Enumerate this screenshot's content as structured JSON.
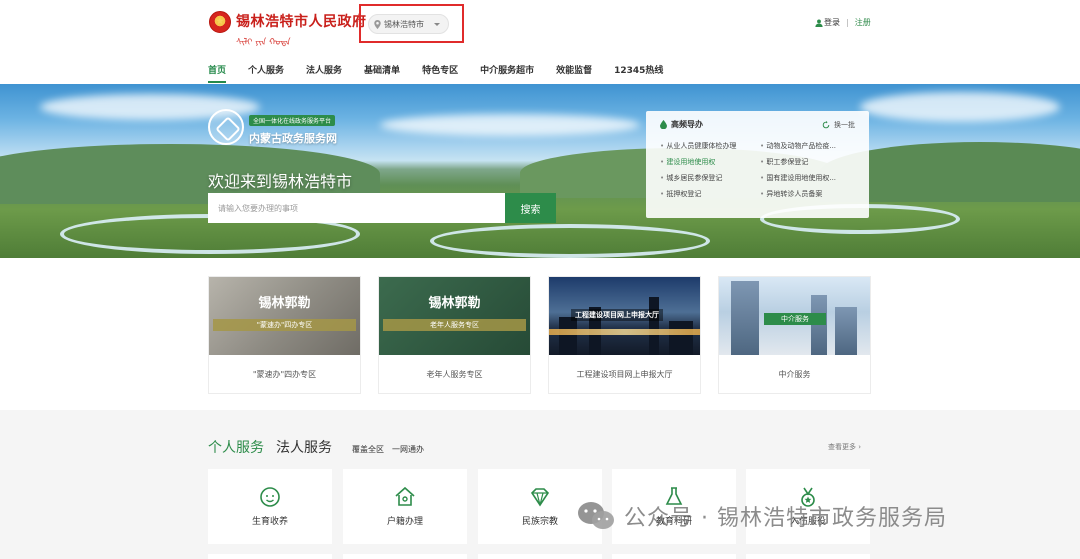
{
  "header": {
    "site_title": "锡林浩特市人民政府",
    "mongolian_line": "ᠰᠢᠯᠢ ᠶᠢᠨ ᠬᠣᠲᠠ",
    "city": "锡林浩特市",
    "login": "登录",
    "separator": "|",
    "register": "注册"
  },
  "nav": [
    "首页",
    "个人服务",
    "法人服务",
    "基础清单",
    "特色专区",
    "中介服务超市",
    "效能监督",
    "12345热线"
  ],
  "hero": {
    "platform_tag": "全国一体化在线政务服务平台",
    "platform_name": "内蒙古政务服务网",
    "welcome": "欢迎来到锡林浩特市",
    "search_placeholder": "请输入您要办理的事项",
    "search_button": "搜索"
  },
  "hot": {
    "title": "高频导办",
    "refresh": "换一批",
    "items": [
      {
        "label": "从业人员健康体检办理",
        "highlight": false
      },
      {
        "label": "动物及动物产品检疫...",
        "highlight": false
      },
      {
        "label": "建设用地使用权",
        "highlight": true
      },
      {
        "label": "职工参保登记",
        "highlight": false
      },
      {
        "label": "城乡居民参保登记",
        "highlight": false
      },
      {
        "label": "国有建设用地使用权...",
        "highlight": false
      },
      {
        "label": "抵押权登记",
        "highlight": false
      },
      {
        "label": "异地转诊人员备案",
        "highlight": false
      }
    ]
  },
  "cards": [
    {
      "big": "锡林郭勒",
      "band": "\"蒙速办\"四办专区",
      "caption": "\"蒙速办\"四办专区"
    },
    {
      "big": "锡林郭勒",
      "band": "老年人服务专区",
      "caption": "老年人服务专区"
    },
    {
      "big": "",
      "band": "工程建设项目网上申报大厅",
      "caption": "工程建设项目网上申报大厅"
    },
    {
      "big": "",
      "band": "中介服务",
      "caption": "中介服务"
    }
  ],
  "services": {
    "tab_personal": "个人服务",
    "tab_legal": "法人服务",
    "sub_all": "覆盖全区",
    "sub_one": "一网通办",
    "more": "查看更多 ›",
    "tiles": [
      "生育收养",
      "户籍办理",
      "民族宗教",
      "教育科研",
      "入伍服役"
    ]
  },
  "watermark": "公众号 · 锡林浩特市政务服务局",
  "colors": {
    "brand_green": "#2d8c4a",
    "gov_red": "#c9201b",
    "highlight_box": "#e02b2b"
  }
}
